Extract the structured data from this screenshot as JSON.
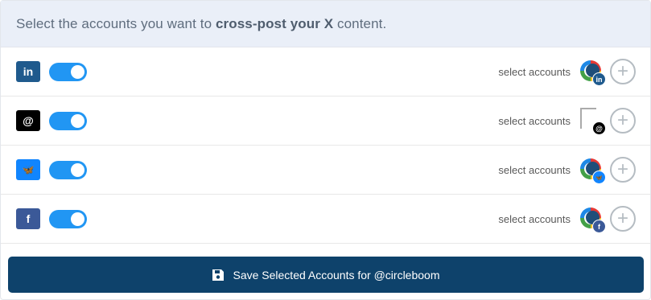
{
  "header": {
    "prefix": "Select the accounts you want to ",
    "bold1": "cross-post your X",
    "middle": " content",
    "suffix": "."
  },
  "rows": [
    {
      "network_icon": "linkedin-icon",
      "icon_text": "in",
      "brand_color": "#1f5a8d",
      "toggle_on": true,
      "select_label": "select accounts",
      "mini_text": "in",
      "mini_color": "#1f5a8d"
    },
    {
      "network_icon": "threads-icon",
      "icon_text": "@",
      "brand_color": "#000000",
      "toggle_on": true,
      "select_label": "select accounts",
      "mini_text": "@",
      "mini_color": "#000000"
    },
    {
      "network_icon": "bluesky-icon",
      "icon_text": "🦋",
      "brand_color": "#1185fe",
      "toggle_on": true,
      "select_label": "select accounts",
      "mini_text": "🦋",
      "mini_color": "#1185fe"
    },
    {
      "network_icon": "facebook-icon",
      "icon_text": "f",
      "brand_color": "#3b5998",
      "toggle_on": true,
      "select_label": "select accounts",
      "mini_text": "f",
      "mini_color": "#3b5998"
    }
  ],
  "save_button": {
    "label": "Save Selected Accounts for @circleboom",
    "icon": "floppy-disk-icon",
    "color": "#0e426b"
  },
  "toggle_color": "#2196f3"
}
